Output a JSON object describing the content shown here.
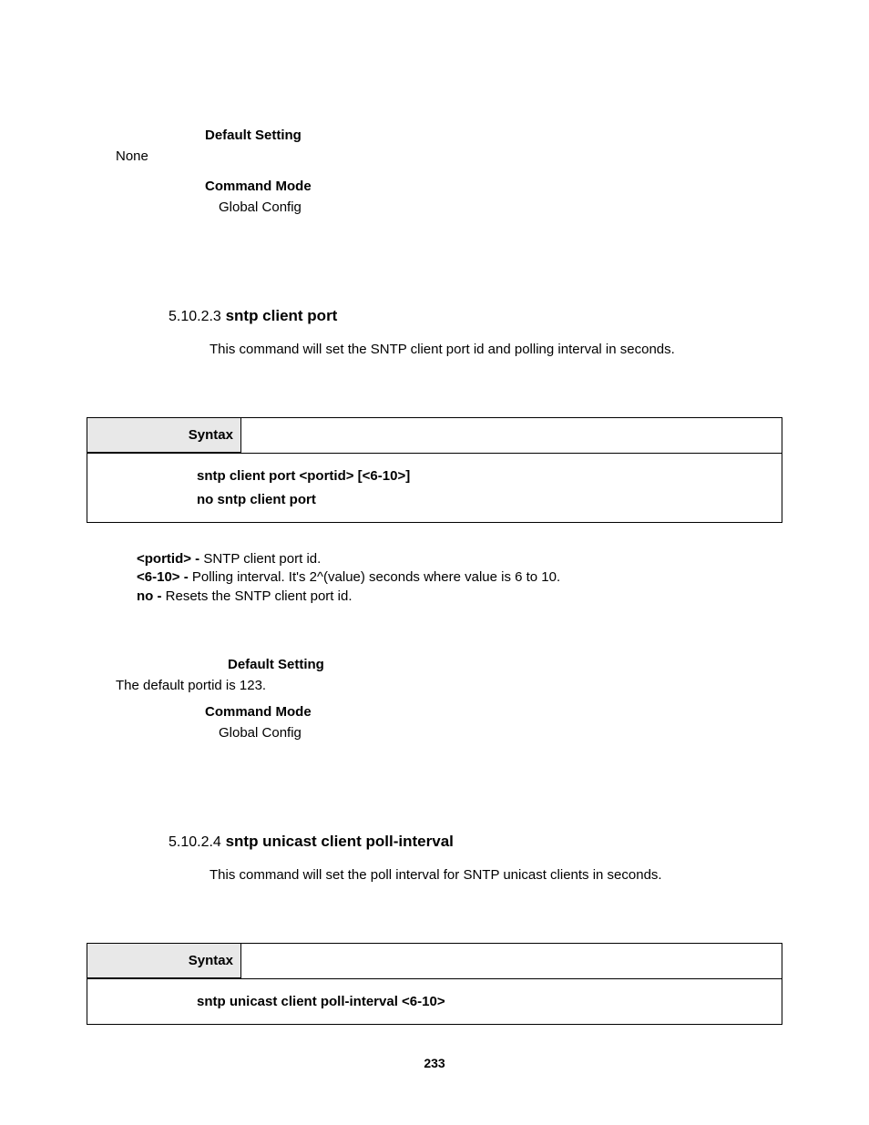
{
  "section1": {
    "default_setting_label": "Default Setting",
    "default_setting_value": "None",
    "command_mode_label": "Command Mode",
    "command_mode_value": "Global Config"
  },
  "section2": {
    "heading_num": "5.10.2.3",
    "heading_title": "sntp client port",
    "description": "This command will set the SNTP client port id and polling interval in seconds.",
    "syntax_label": "Syntax",
    "syntax_cmd1": "sntp client port <portid> [<6-10>]",
    "syntax_cmd2": "no sntp client port",
    "params": {
      "p1_key": "<portid> -",
      "p1_val": " SNTP client port id.",
      "p2_key": "<6-10> -",
      "p2_val": " Polling interval. It's 2^(value) seconds where value is 6 to 10.",
      "p3_key": "no -",
      "p3_val": " Resets the SNTP client port id."
    },
    "default_setting_label": "Default Setting",
    "default_setting_value": "The default portid is 123.",
    "command_mode_label": "Command Mode",
    "command_mode_value": "Global Config"
  },
  "section3": {
    "heading_num": "5.10.2.4",
    "heading_title": "sntp unicast client poll-interval",
    "description": "This command will set the poll interval for SNTP unicast clients in seconds.",
    "syntax_label": "Syntax",
    "syntax_cmd1": "sntp unicast client poll-interval <6-10>"
  },
  "page_number": "233"
}
